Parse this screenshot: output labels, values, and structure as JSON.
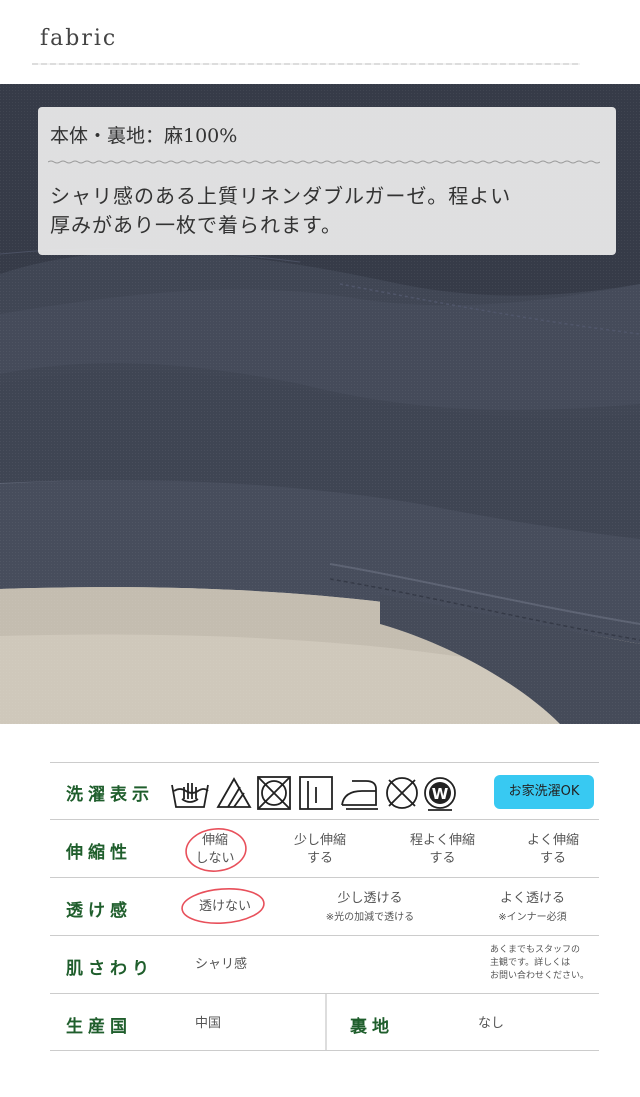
{
  "header": {
    "title": "fabric"
  },
  "caption": {
    "material": "本体・裏地：麻100%",
    "description_line1": "シャリ感のある上質リネンダブルガーゼ。程よい",
    "description_line2": "厚みがあり一枚で着られます。"
  },
  "table": {
    "care": {
      "label": "洗濯表示",
      "icons": [
        "hand-wash-icon",
        "bleach-triangle-icon",
        "no-tumble-dry-icon",
        "line-dry-icon",
        "iron-icon",
        "no-dry-clean-icon",
        "wet-clean-w-icon"
      ],
      "badge": "お家洗濯OK",
      "badge_color": "#38c9f2"
    },
    "stretch": {
      "label": "伸縮性",
      "options": [
        {
          "line1": "伸縮",
          "line2": "しない"
        },
        {
          "line1": "少し伸縮",
          "line2": "する"
        },
        {
          "line1": "程よく伸縮",
          "line2": "する"
        },
        {
          "line1": "よく伸縮",
          "line2": "する"
        }
      ],
      "selected": "伸縮しない"
    },
    "sheer": {
      "label": "透け感",
      "options": [
        {
          "line1": "透けない",
          "line2": ""
        },
        {
          "line1": "少し透ける",
          "line2": "※光の加減で透ける"
        },
        {
          "line1": "よく透ける",
          "line2": "※インナー必須"
        }
      ],
      "selected": "透けない"
    },
    "texture": {
      "label": "肌さわり",
      "value": "シャリ感",
      "note_line1": "あくまでもスタッフの",
      "note_line2": "主観です。詳しくは",
      "note_line3": "お問い合わせください。"
    },
    "origin": {
      "label": "生産国",
      "value": "中国",
      "lining_label": "裏地",
      "lining_value": "なし"
    },
    "highlight_color": "#e8505b"
  }
}
